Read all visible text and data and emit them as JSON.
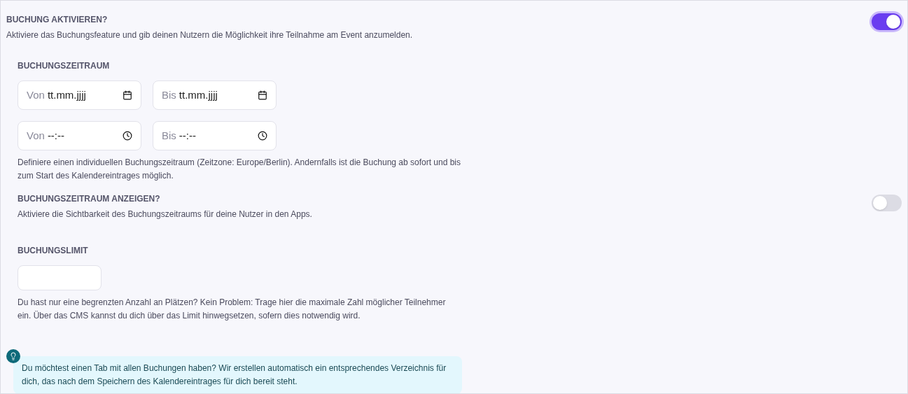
{
  "booking": {
    "title": "BUCHUNG AKTIVIEREN?",
    "description": "Aktiviere das Buchungsfeature und gib deinen Nutzern die Möglichkeit ihre Teilnahme am Event anzumelden.",
    "on": true
  },
  "period": {
    "title": "BUCHUNGSZEITRAUM",
    "fields": [
      {
        "kind": "date",
        "label": "Von",
        "value": "tt.mm.jjjj"
      },
      {
        "kind": "date",
        "label": "Bis",
        "value": "tt.mm.jjjj"
      },
      {
        "kind": "time",
        "label": "Von",
        "value": "--:--"
      },
      {
        "kind": "time",
        "label": "Bis",
        "value": "--:--"
      }
    ],
    "help": "Definiere einen individuellen Buchungszeitraum (Zeitzone: Europe/Berlin). Andernfalls ist die Buchung ab sofort und bis zum Start des Kalendereintrages möglich."
  },
  "show_period": {
    "title": "BUCHUNGSZEITRAUM ANZEIGEN?",
    "description": "Aktiviere die Sichtbarkeit des Buchungszeitraums für deine Nutzer in den Apps.",
    "on": false
  },
  "limit": {
    "title": "BUCHUNGSLIMIT",
    "help": "Du hast nur eine begrenzten Anzahl an Plätzen? Kein Problem: Trage hier die maximale Zahl möglicher Teilnehmer ein. Über das CMS kannst du dich über das Limit hinwegsetzen, sofern dies notwendig wird."
  },
  "tip": {
    "text": "Du möchtest einen Tab mit allen Buchungen haben? Wir erstellen automatisch ein entsprechendes Verzeichnis für dich, das nach dem Speichern des Kalendereintrages für dich bereit steht."
  }
}
